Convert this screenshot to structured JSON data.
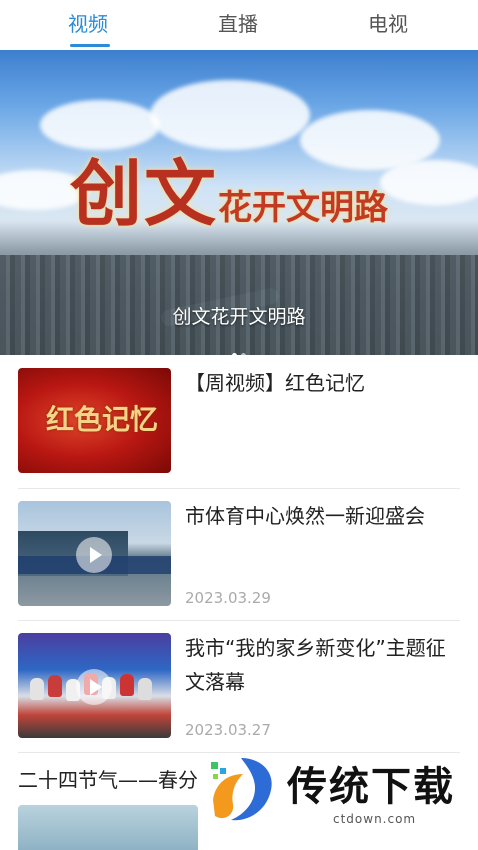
{
  "tabs": [
    {
      "label": "视频",
      "active": true
    },
    {
      "label": "直播",
      "active": false
    },
    {
      "label": "电视",
      "active": false
    }
  ],
  "accent_color": "#2a8bd8",
  "banner": {
    "art_title_big": "创文",
    "art_title_small": "花开文明路",
    "caption": "创文花开文明路"
  },
  "videos": [
    {
      "title": "【周视频】红色记忆",
      "date": "",
      "thumb_text": "红色记忆"
    },
    {
      "title": "市体育中心焕然一新迎盛会",
      "date": "2023.03.29"
    },
    {
      "title": "我市“我的家乡新变化”主题征文落幕",
      "date": "2023.03.27"
    }
  ],
  "partial_item": {
    "title": "二十四节气——春分"
  },
  "watermark": {
    "name": "传统下载",
    "url": "ctdown.com"
  }
}
